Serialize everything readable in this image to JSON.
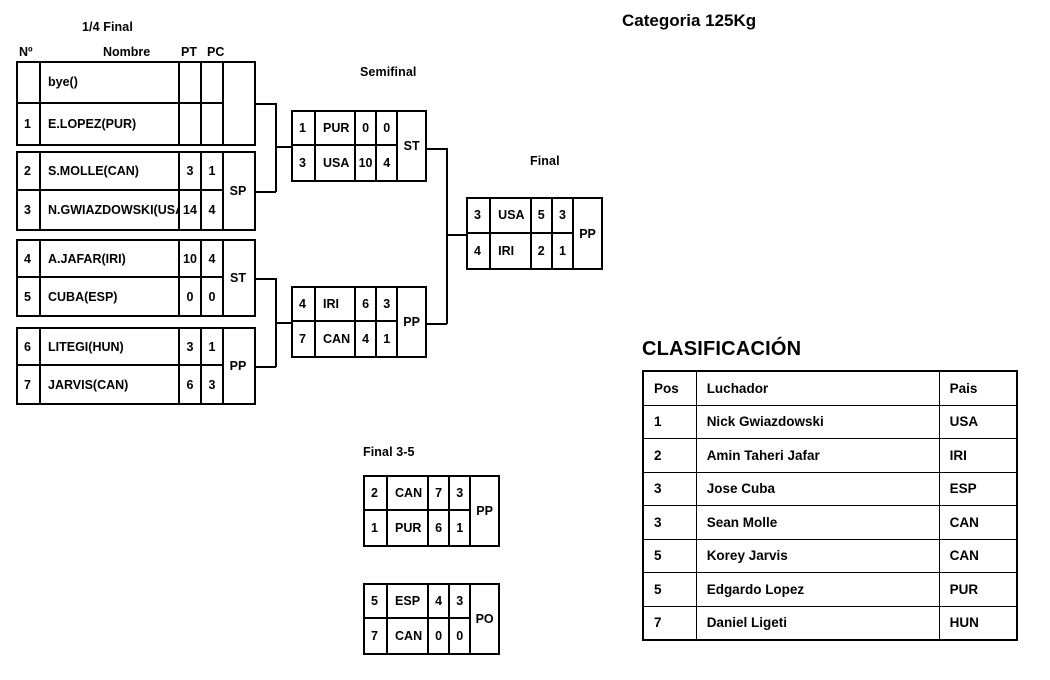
{
  "category_title": "Categoria 125Kg",
  "rounds": {
    "quarterfinal_label": "1/4 Final",
    "semifinal_label": "Semifinal",
    "final_label": "Final",
    "final35_label": "Final 3-5"
  },
  "columns": {
    "number": "Nº",
    "name": "Nombre",
    "points": "PT",
    "classification_points": "PC"
  },
  "quarterfinals": [
    {
      "result": "",
      "rows": [
        {
          "no": "",
          "name": "bye()",
          "pt": "",
          "pc": ""
        },
        {
          "no": "1",
          "name": "E.LOPEZ(PUR)",
          "pt": "",
          "pc": ""
        }
      ]
    },
    {
      "result": "SP",
      "rows": [
        {
          "no": "2",
          "name": "S.MOLLE(CAN)",
          "pt": "3",
          "pc": "1"
        },
        {
          "no": "3",
          "name": "N.GWIAZDOWSKI(USA)",
          "pt": "14",
          "pc": "4"
        }
      ]
    },
    {
      "result": "ST",
      "rows": [
        {
          "no": "4",
          "name": "A.JAFAR(IRI)",
          "pt": "10",
          "pc": "4"
        },
        {
          "no": "5",
          "name": "CUBA(ESP)",
          "pt": "0",
          "pc": "0"
        }
      ]
    },
    {
      "result": "PP",
      "rows": [
        {
          "no": "6",
          "name": "LITEGI(HUN)",
          "pt": "3",
          "pc": "1"
        },
        {
          "no": "7",
          "name": "JARVIS(CAN)",
          "pt": "6",
          "pc": "3"
        }
      ]
    }
  ],
  "semifinals": [
    {
      "result": "ST",
      "rows": [
        {
          "no": "1",
          "name": "PUR",
          "pt": "0",
          "pc": "0"
        },
        {
          "no": "3",
          "name": "USA",
          "pt": "10",
          "pc": "4"
        }
      ]
    },
    {
      "result": "PP",
      "rows": [
        {
          "no": "4",
          "name": "IRI",
          "pt": "6",
          "pc": "3"
        },
        {
          "no": "7",
          "name": "CAN",
          "pt": "4",
          "pc": "1"
        }
      ]
    }
  ],
  "final": {
    "result": "PP",
    "rows": [
      {
        "no": "3",
        "name": "USA",
        "pt": "5",
        "pc": "3"
      },
      {
        "no": "4",
        "name": "IRI",
        "pt": "2",
        "pc": "1"
      }
    ]
  },
  "final35": [
    {
      "result": "PP",
      "rows": [
        {
          "no": "2",
          "name": "CAN",
          "pt": "7",
          "pc": "3"
        },
        {
          "no": "1",
          "name": "PUR",
          "pt": "6",
          "pc": "1"
        }
      ]
    },
    {
      "result": "PO",
      "rows": [
        {
          "no": "5",
          "name": "ESP",
          "pt": "4",
          "pc": "3"
        },
        {
          "no": "7",
          "name": "CAN",
          "pt": "0",
          "pc": "0"
        }
      ]
    }
  ],
  "clasificacion": {
    "title": "CLASIFICACIÓN",
    "headers": [
      "Pos",
      "Luchador",
      "Pais"
    ],
    "rows": [
      {
        "pos": "1",
        "luchador": "Nick Gwiazdowski",
        "pais": "USA"
      },
      {
        "pos": "2",
        "luchador": "Amin Taheri Jafar",
        "pais": "IRI"
      },
      {
        "pos": "3",
        "luchador": "Jose Cuba",
        "pais": "ESP"
      },
      {
        "pos": "3",
        "luchador": "Sean Molle",
        "pais": "CAN"
      },
      {
        "pos": "5",
        "luchador": "Korey Jarvis",
        "pais": "CAN"
      },
      {
        "pos": "5",
        "luchador": "Edgardo Lopez",
        "pais": "PUR"
      },
      {
        "pos": "7",
        "luchador": "Daniel Ligeti",
        "pais": "HUN"
      }
    ]
  },
  "colors": {
    "line": "#000000",
    "background": "#ffffff"
  }
}
